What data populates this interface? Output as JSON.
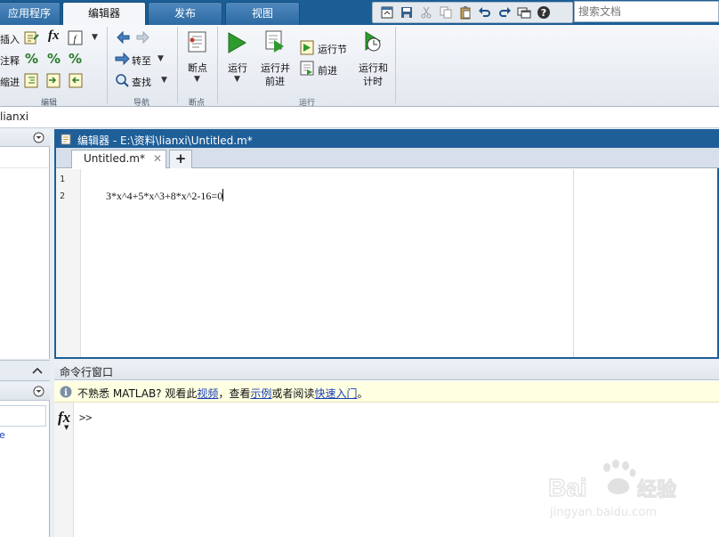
{
  "tabs": {
    "apps": "应用程序",
    "editor": "编辑器",
    "publish": "发布",
    "view": "视图"
  },
  "search": {
    "placeholder": "搜索文档"
  },
  "quick_access": [
    "save-icon",
    "cut-icon",
    "copy-icon",
    "paste-icon",
    "undo-icon",
    "redo-icon",
    "switch-window-icon",
    "help-icon"
  ],
  "ribbon": {
    "edit_group": {
      "insert": "插入",
      "comment": "注释",
      "indent": "缩进",
      "fx": "fx",
      "label": "编辑"
    },
    "nav_group": {
      "goto": "转至",
      "find": "查找",
      "label": "导航"
    },
    "breakpoint_group": {
      "breakpoint": "断点",
      "label": "断点"
    },
    "run_group": {
      "run": "运行",
      "run_advance_1": "运行并",
      "run_advance_2": "前进",
      "run_section": "运行节",
      "advance": "前进",
      "run_time_1": "运行和",
      "run_time_2": "计时",
      "label": "运行"
    }
  },
  "address": {
    "path": "lianxi"
  },
  "editor": {
    "title": "编辑器 - E:\\资料\\lianxi\\Untitled.m*",
    "tab_label": "Untitled.m*",
    "add_tab": "+",
    "line_numbers": [
      "1",
      "2"
    ],
    "code_line_2": "3*x^4+5*x^3+8*x^2-16=0"
  },
  "command_window": {
    "title": "命令行窗口",
    "info_prefix": "不熟悉 MATLAB? 观看此",
    "info_link_video": "视频",
    "info_mid": "，查看",
    "info_link_examples": "示例",
    "info_mid2": "或者阅读",
    "info_link_start": "快速入门",
    "info_suffix": "。",
    "prompt": ">>",
    "fx": "fx"
  },
  "left_panel": {
    "stray_text": "e"
  },
  "watermark": {
    "brand": "Bai du 经验",
    "url": "jingyan.baidu.com"
  },
  "colors": {
    "title_blue": "#1f5f98",
    "tab_bar": "#1b5e96",
    "info_bg": "#ffffe1",
    "link": "#1a3fb8",
    "run_green": "#2e9b2e"
  }
}
